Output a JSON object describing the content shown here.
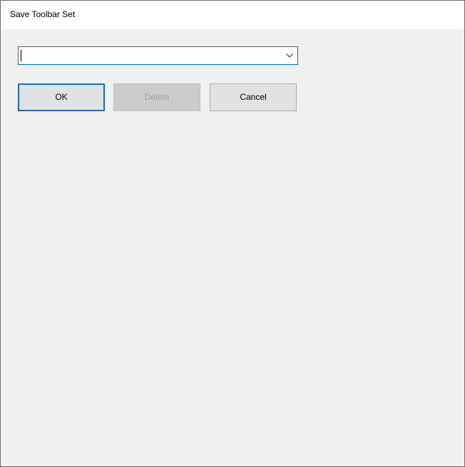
{
  "window": {
    "title": "Save Toolbar Set"
  },
  "toolbar_set_combo": {
    "value": "",
    "dropdown_icon": "chevron-down-icon"
  },
  "buttons": {
    "ok_label": "OK",
    "delete_label": "Delete",
    "cancel_label": "Cancel"
  },
  "colors": {
    "focus_accent": "#0078d7",
    "dialog_background": "#f0f0f0",
    "button_face": "#e1e1e1",
    "disabled_text": "#a0a0a0"
  }
}
